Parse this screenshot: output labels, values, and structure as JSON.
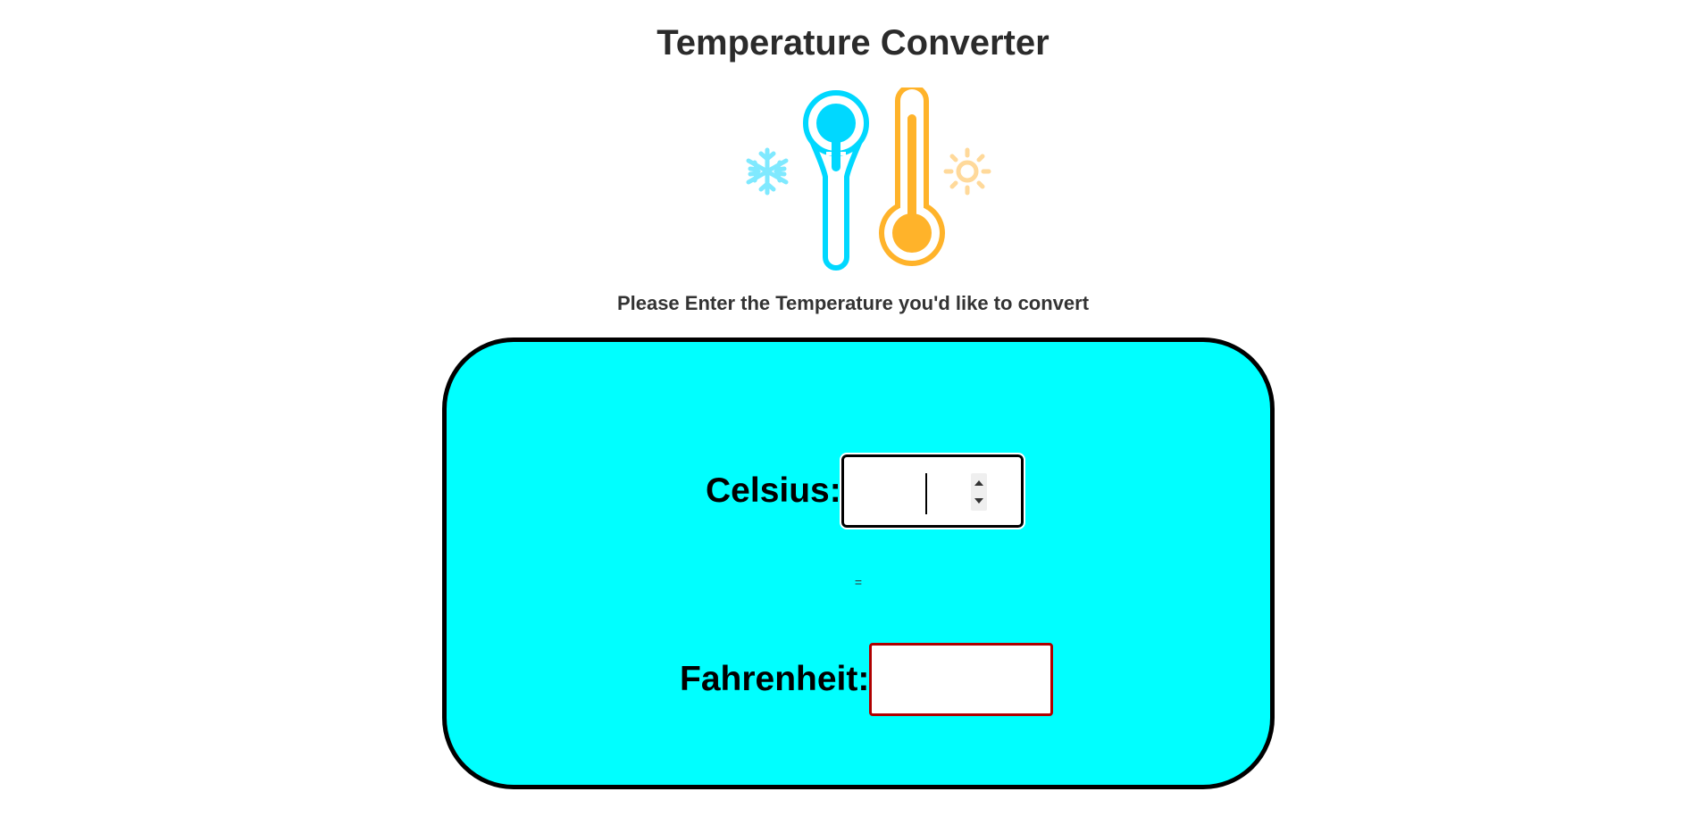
{
  "header": {
    "title": "Temperature Converter"
  },
  "illustration": {
    "icons": [
      "snowflake-icon",
      "cold-thermometer-icon",
      "hot-thermometer-icon",
      "sun-icon"
    ],
    "colors": {
      "cold": "#00d8ff",
      "cold_light": "#7fe9ff",
      "hot": "#ffb32a",
      "hot_light": "#ffd99a"
    }
  },
  "instructions": {
    "text": "Please Enter the Temperature you'd like to convert"
  },
  "converter": {
    "background_color": "#00ffff",
    "celsius": {
      "label": "Celsius:",
      "value": "",
      "placeholder": ""
    },
    "equals_sign": "=",
    "fahrenheit": {
      "label": "Fahrenheit:",
      "value": "",
      "placeholder": ""
    }
  }
}
